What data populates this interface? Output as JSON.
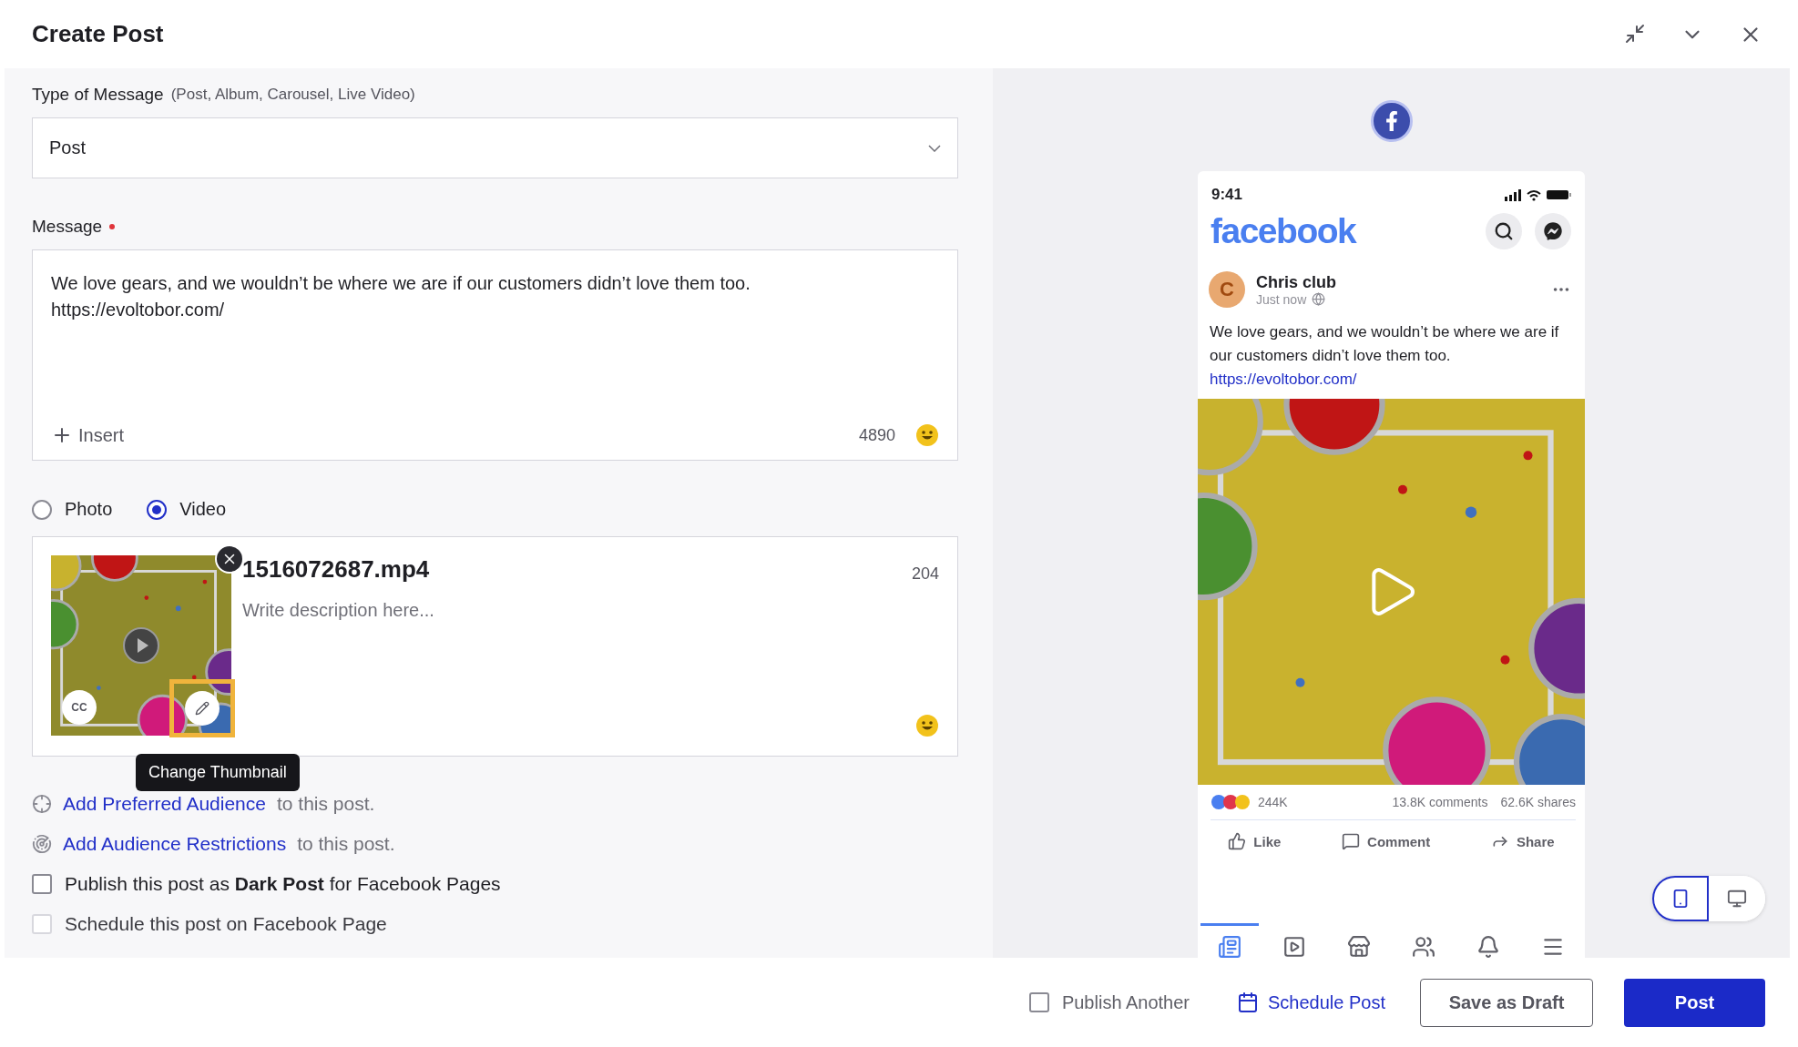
{
  "header": {
    "title": "Create Post"
  },
  "type_of_message": {
    "label": "Type of Message",
    "hint": "(Post, Album, Carousel, Live Video)",
    "value": "Post"
  },
  "message": {
    "label": "Message",
    "required": true,
    "text": "We love gears, and we wouldn’t be where we are if our customers didn’t love them too.\nhttps://evoltobor.com/",
    "insert": "Insert",
    "count": "4890"
  },
  "media_type": [
    {
      "label": "Photo",
      "selected": false
    },
    {
      "label": "Video",
      "selected": true
    }
  ],
  "video": {
    "filename": "1516072687.mp4",
    "placeholder": "Write description here...",
    "count": "204",
    "cc": "CC",
    "tooltip": "Change Thumbnail"
  },
  "audience": [
    {
      "kind": "preferred",
      "link": "Add Preferred Audience",
      "rest": "to this post."
    },
    {
      "kind": "restrictions",
      "link": "Add Audience Restrictions",
      "rest": "to this post."
    }
  ],
  "options": [
    {
      "label": "Publish this post as **Dark Post** for Facebook Pages",
      "checked": false,
      "disabled": false
    },
    {
      "label": "Schedule this post on Facebook Page",
      "checked": false,
      "disabled": true
    }
  ],
  "preview": {
    "time": "9:41",
    "brand": "facebook",
    "author": "Chris club",
    "avatar": "C",
    "meta": "Just now",
    "text": "We love gears, and we wouldn’t be where we are if our customers didn’t love them too.",
    "link": "https://evoltobor.com/",
    "reactions": "244K",
    "comments": "13.8K comments",
    "shares": "62.6K shares",
    "actions": [
      {
        "kind": "like",
        "label": "Like"
      },
      {
        "kind": "comment",
        "label": "Comment"
      },
      {
        "kind": "share",
        "label": "Share"
      }
    ],
    "nav": [
      {
        "kind": "feed",
        "selected": true
      },
      {
        "kind": "watch",
        "selected": false
      },
      {
        "kind": "market",
        "selected": false
      },
      {
        "kind": "groups",
        "selected": false
      },
      {
        "kind": "bell",
        "selected": false
      },
      {
        "kind": "menu",
        "selected": false
      }
    ]
  },
  "devices": [
    {
      "kind": "mobile",
      "selected": true
    },
    {
      "kind": "desktop",
      "selected": false
    }
  ],
  "footer": {
    "publish_another": {
      "label": "Publish Another",
      "checked": false
    },
    "schedule": "Schedule Post",
    "save": "Save as Draft",
    "post": "Post"
  }
}
